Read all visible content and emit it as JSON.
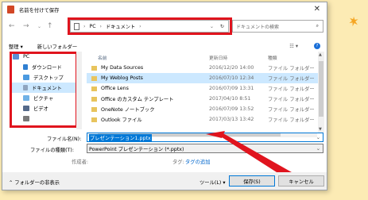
{
  "window": {
    "title": "名前を付けて保存"
  },
  "nav": {
    "path": [
      "PC",
      "ドキュメント"
    ],
    "search_placeholder": "ドキュメントの検索"
  },
  "toolbar": {
    "organize": "整理 ▾",
    "new_folder": "新しいフォルダー"
  },
  "tree": {
    "items": [
      {
        "label": "PC",
        "icon": "pc-icon"
      },
      {
        "label": "ダウンロード",
        "icon": "download-icon"
      },
      {
        "label": "デスクトップ",
        "icon": "desktop-icon"
      },
      {
        "label": "ドキュメント",
        "icon": "documents-icon"
      },
      {
        "label": "ピクチャ",
        "icon": "pictures-icon"
      },
      {
        "label": "ビデオ",
        "icon": "videos-icon"
      }
    ]
  },
  "list": {
    "columns": {
      "name": "名前",
      "date": "更新日時",
      "type": "種類"
    },
    "rows": [
      {
        "name": "My Data Sources",
        "date": "2016/12/20 14:00",
        "type": "ファイル フォルダー"
      },
      {
        "name": "My Weblog Posts",
        "date": "2016/07/10 12:34",
        "type": "ファイル フォルダー"
      },
      {
        "name": "Office Lens",
        "date": "2016/07/09 13:31",
        "type": "ファイル フォルダー"
      },
      {
        "name": "Office のカスタム テンプレート",
        "date": "2017/04/10 8:51",
        "type": "ファイル フォルダー"
      },
      {
        "name": "OneNote ノートブック",
        "date": "2016/07/09 13:52",
        "type": "ファイル フォルダー"
      },
      {
        "name": "Outlook ファイル",
        "date": "2017/03/13 13:42",
        "type": "ファイル フォルダー"
      }
    ]
  },
  "form": {
    "filename_label": "ファイル名(N):",
    "filename_value": "プレゼンテーション1.pptx",
    "filetype_label": "ファイルの種類(T):",
    "filetype_value": "PowerPoint プレゼンテーション (*.pptx)",
    "author_label": "作成者:",
    "tags_label": "タグ:",
    "tags_value": "タグの追加"
  },
  "footer": {
    "hide_folders": "フォルダーの非表示",
    "tools": "ツール(L)",
    "save": "保存(S)",
    "cancel": "キャンセル"
  },
  "colors": {
    "annotation_red": "#e0141e",
    "selection": "#cce8ff",
    "accent": "#0078d7",
    "page_bg": "#fcebb4"
  }
}
